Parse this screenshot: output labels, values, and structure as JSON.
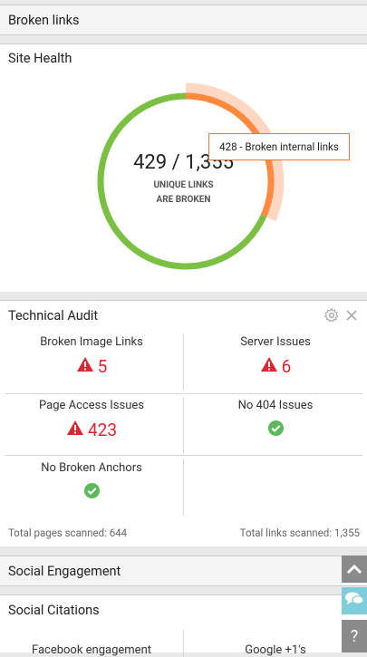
{
  "header": {
    "title": "Broken links"
  },
  "site_health": {
    "title": "Site Health",
    "center_value": "429 / 1,355",
    "center_line1": "UNIQUE LINKS",
    "center_line2": "ARE BROKEN",
    "tooltip": "428 - Broken internal links",
    "ring": {
      "broken_fraction": 0.3166,
      "colors": {
        "ok": "#7bc043",
        "broken": "#ff8a3d",
        "highlight": "#ffd8c3"
      }
    }
  },
  "technical_audit": {
    "title": "Technical Audit",
    "cells": [
      {
        "label": "Broken Image Links",
        "value": "5"
      },
      {
        "label": "Server Issues",
        "value": "6"
      },
      {
        "label": "Page Access Issues",
        "value": "423"
      },
      {
        "label": "No 404 Issues"
      },
      {
        "label": "No Broken Anchors"
      }
    ],
    "footer_left": "Total pages scanned: 644",
    "footer_right": "Total links scanned: 1,355"
  },
  "social_engagement": {
    "title": "Social Engagement"
  },
  "social_citations": {
    "title": "Social Citations",
    "col1": "Facebook engagement",
    "col2": "Google +1's"
  },
  "side": {
    "help": "?"
  },
  "colors": {
    "error": "#d9282f",
    "ok": "#5cb85c"
  }
}
